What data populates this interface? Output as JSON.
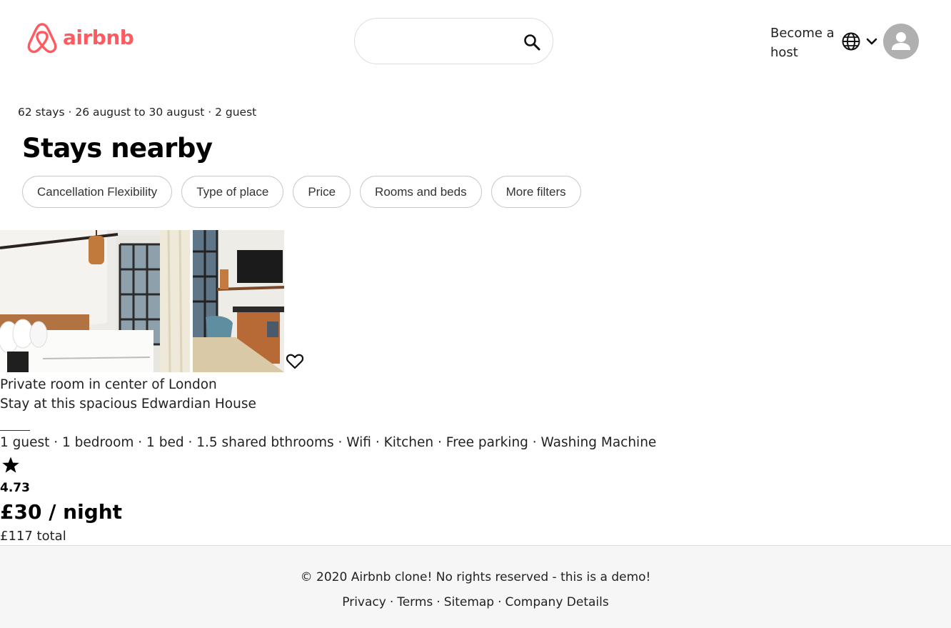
{
  "header": {
    "logo_text": "airbnb",
    "search_placeholder": "",
    "become_host": "Become a host",
    "brand_color": "#ff5a5f"
  },
  "results": {
    "summary": "62 stays · 26 august to 30 august · 2 guest",
    "title": "Stays nearby",
    "filters": [
      "Cancellation Flexibility",
      "Type of place",
      "Price",
      "Rooms and beds",
      "More filters"
    ]
  },
  "listing": {
    "type": "Private room in center of London",
    "name": "Stay at this spacious Edwardian House",
    "amenities": "1 guest · 1 bedroom · 1 bed · 1.5 shared bthrooms · Wifi · Kitchen · Free parking · Washing Machine",
    "rating": "4.73",
    "price": "£30 / night",
    "total": "£117 total",
    "icons": [
      "heart-icon",
      "star-icon"
    ]
  },
  "footer": {
    "copyright": "© 2020 Airbnb clone! No rights reserved - this is a demo!",
    "links": [
      "Privacy",
      "Terms",
      "Sitemap",
      "Company Details"
    ],
    "separator": "·"
  }
}
